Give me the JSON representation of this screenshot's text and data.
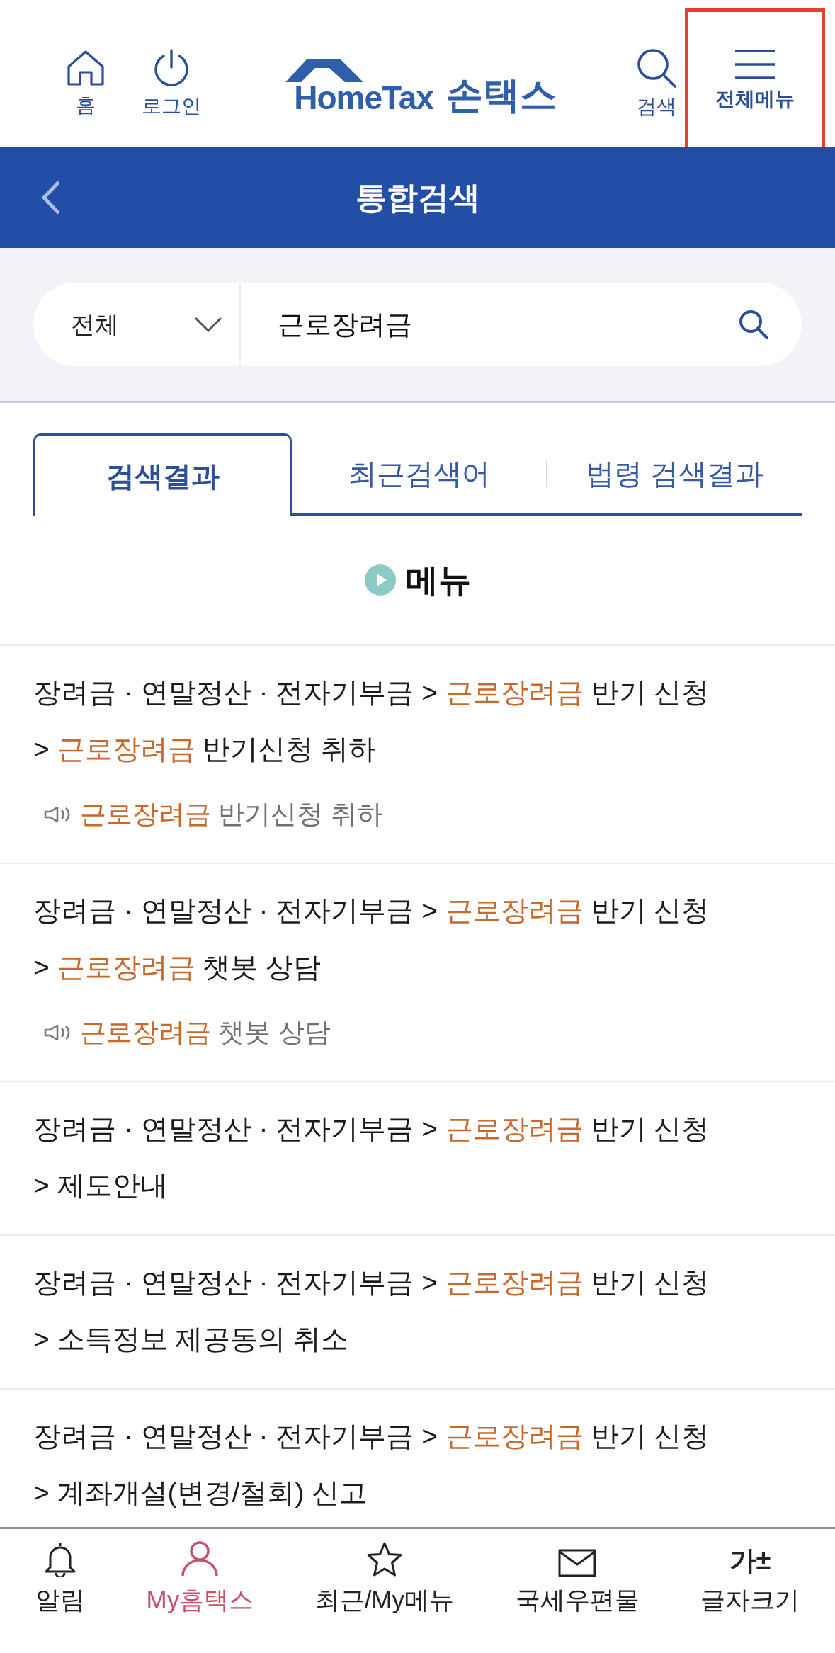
{
  "header": {
    "buttons_left": [
      {
        "kind": "home",
        "label": "홈",
        "highlighted": false
      },
      {
        "kind": "power",
        "label": "로그인",
        "highlighted": false
      }
    ],
    "logo": {
      "latin": "HomeTax",
      "hangul": "손택스"
    },
    "buttons_right": [
      {
        "kind": "search",
        "label": "검색",
        "highlighted": false
      },
      {
        "kind": "menu",
        "label": "전체메뉴",
        "highlighted": true
      }
    ]
  },
  "title_bar": {
    "title": "통합검색"
  },
  "search": {
    "scope": "전체",
    "value": "근로장려금"
  },
  "tabs": [
    {
      "label": "검색결과",
      "selected": true
    },
    {
      "label": "최근검색어",
      "selected": false
    },
    {
      "label": "법령 검색결과",
      "selected": false
    }
  ],
  "section": {
    "title": "메뉴"
  },
  "results": [
    {
      "breadcrumb": [
        {
          "text": "장려금 · 연말정산 · 전자기부금 > ",
          "match": false
        },
        {
          "text": "근로장려금",
          "match": true
        },
        {
          "text": " 반기 신청",
          "match": false
        }
      ],
      "path": [
        {
          "text": "> ",
          "match": false
        },
        {
          "text": "근로장려금",
          "match": true
        },
        {
          "text": " 반기신청 취하",
          "match": false
        }
      ],
      "speech": [
        {
          "text": "근로장려금",
          "match": true
        },
        {
          "text": " 반기신청 취하",
          "match": false
        }
      ]
    },
    {
      "breadcrumb": [
        {
          "text": "장려금 · 연말정산 · 전자기부금 > ",
          "match": false
        },
        {
          "text": "근로장려금",
          "match": true
        },
        {
          "text": " 반기 신청",
          "match": false
        }
      ],
      "path": [
        {
          "text": "> ",
          "match": false
        },
        {
          "text": "근로장려금",
          "match": true
        },
        {
          "text": " 챗봇 상담",
          "match": false
        }
      ],
      "speech": [
        {
          "text": "근로장려금",
          "match": true
        },
        {
          "text": " 챗봇 상담",
          "match": false
        }
      ]
    },
    {
      "breadcrumb": [
        {
          "text": "장려금 · 연말정산 · 전자기부금 > ",
          "match": false
        },
        {
          "text": "근로장려금",
          "match": true
        },
        {
          "text": " 반기 신청",
          "match": false
        }
      ],
      "path": [
        {
          "text": "> 제도안내",
          "match": false
        }
      ]
    },
    {
      "breadcrumb": [
        {
          "text": "장려금 · 연말정산 · 전자기부금 > ",
          "match": false
        },
        {
          "text": "근로장려금",
          "match": true
        },
        {
          "text": " 반기 신청",
          "match": false
        }
      ],
      "path": [
        {
          "text": "> 소득정보 제공동의 취소",
          "match": false
        }
      ]
    },
    {
      "breadcrumb": [
        {
          "text": "장려금 · 연말정산 · 전자기부금 > ",
          "match": false
        },
        {
          "text": "근로장려금",
          "match": true
        },
        {
          "text": " 반기 신청",
          "match": false
        }
      ],
      "path": [
        {
          "text": "> 계좌개설(변경/철회) 신고",
          "match": false
        }
      ]
    }
  ],
  "bottom_nav": [
    {
      "kind": "bell",
      "label": "알림",
      "selected": false
    },
    {
      "kind": "person",
      "label": "My홈택스",
      "selected": true
    },
    {
      "kind": "star",
      "label": "최근/My메뉴",
      "selected": false
    },
    {
      "kind": "mail",
      "label": "국세우편물",
      "selected": false
    },
    {
      "kind": "glyph",
      "glyph": "가±",
      "label": "글자크기",
      "selected": false
    }
  ]
}
